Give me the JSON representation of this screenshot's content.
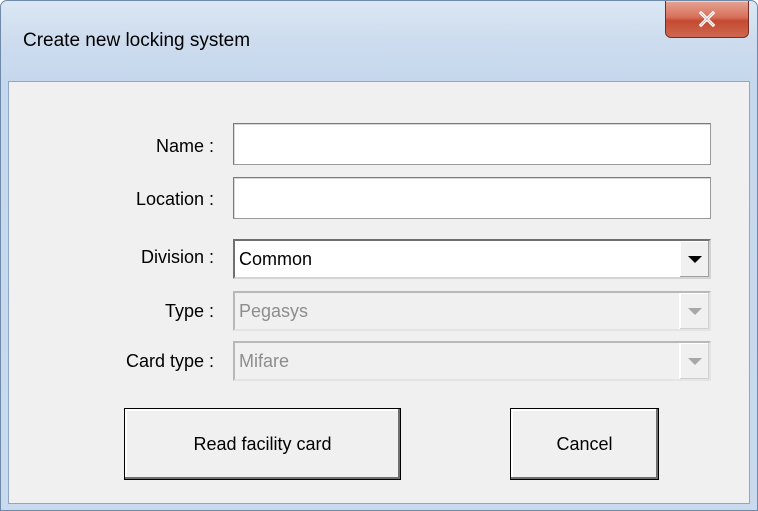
{
  "window": {
    "title": "Create new locking system",
    "close_icon": "close-x-icon"
  },
  "form": {
    "name": {
      "label": "Name :",
      "value": ""
    },
    "location": {
      "label": "Location :",
      "value": ""
    },
    "division": {
      "label": "Division :",
      "value": "Common",
      "icon": "chevron-down-icon"
    },
    "type": {
      "label": "Type :",
      "value": "Pegasys",
      "disabled": true,
      "icon": "chevron-down-icon"
    },
    "card_type": {
      "label": "Card type :",
      "value": "Mifare",
      "disabled": true,
      "icon": "chevron-down-icon"
    }
  },
  "buttons": {
    "read_facility_card": "Read facility card",
    "cancel": "Cancel"
  },
  "colors": {
    "title_bar": "#cddcee",
    "close_button": "#c44a32",
    "client_background": "#f0f0f0",
    "disabled_text": "#8d8d8d"
  }
}
